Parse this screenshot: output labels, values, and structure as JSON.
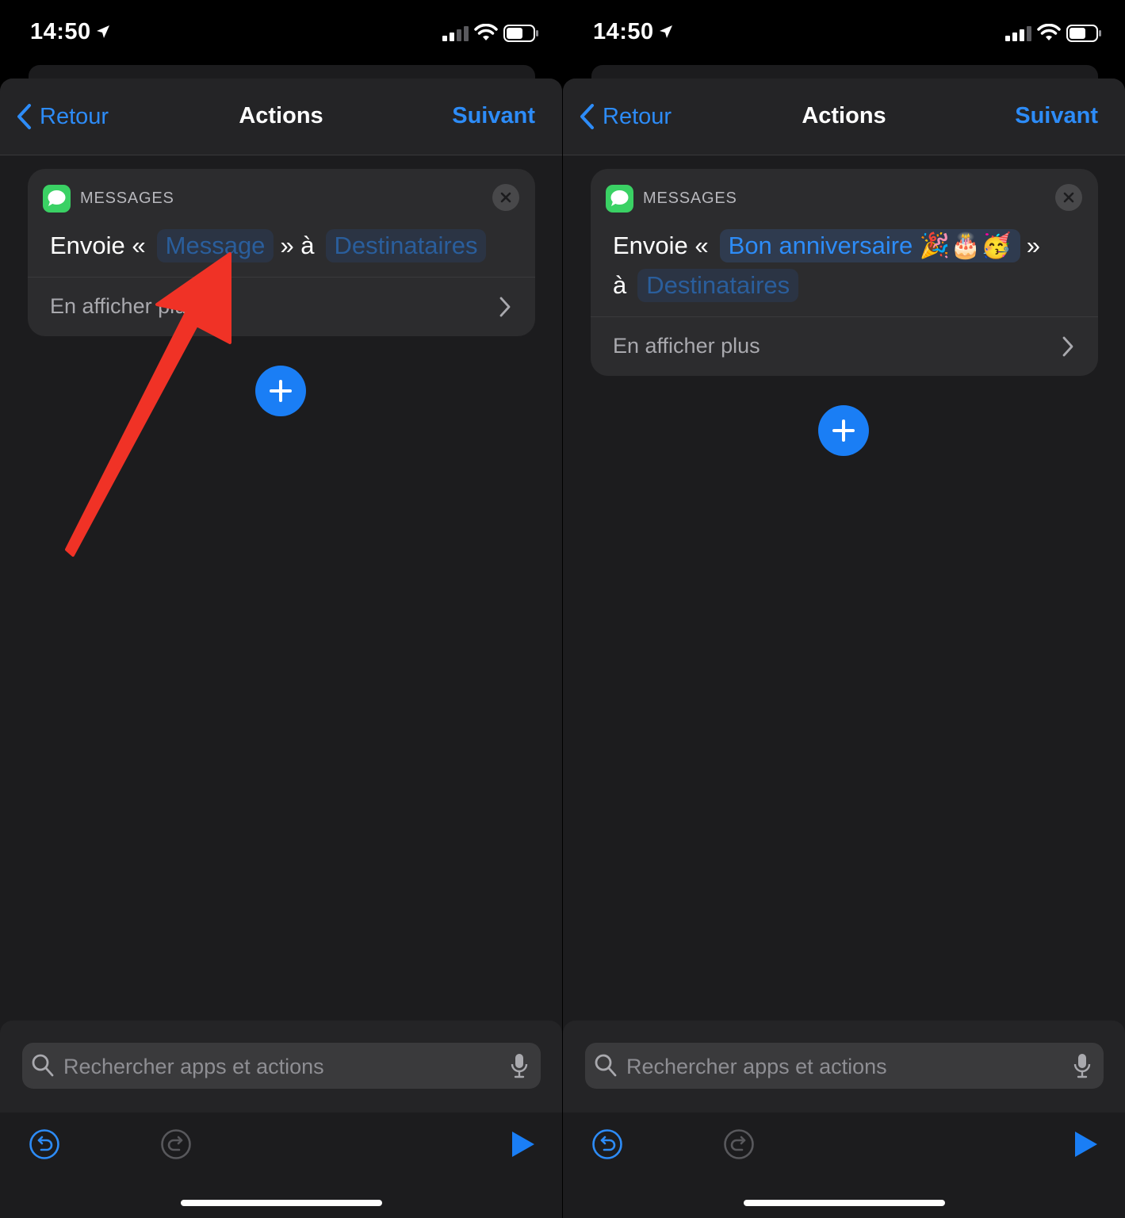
{
  "colors": {
    "accent": "#2d8cf8",
    "background": "#1c1c1e",
    "card": "#2c2c2e",
    "messages_green": "#3ad164",
    "annotation_red": "#f03226"
  },
  "screens": [
    {
      "status": {
        "time": "14:50"
      },
      "nav": {
        "back_label": "Retour",
        "title": "Actions",
        "next_label": "Suivant"
      },
      "card": {
        "app_name": "MESSAGES",
        "verb": "Envoie «",
        "message_value": "Message",
        "connector": "» à",
        "recipients_value": "Destinataires",
        "more_label": "En afficher plus"
      },
      "search": {
        "placeholder": "Rechercher apps et actions"
      }
    },
    {
      "status": {
        "time": "14:50"
      },
      "nav": {
        "back_label": "Retour",
        "title": "Actions",
        "next_label": "Suivant"
      },
      "card": {
        "app_name": "MESSAGES",
        "verb": "Envoie «",
        "message_value": "Bon anniversaire 🎉🎂🥳",
        "close_quote": "»",
        "connector": "à",
        "recipients_value": "Destinataires",
        "more_label": "En afficher plus"
      },
      "search": {
        "placeholder": "Rechercher apps et actions"
      }
    }
  ],
  "icons": [
    "location-arrow-icon",
    "signal-icon",
    "wifi-icon",
    "battery-icon",
    "back-chevron-icon",
    "messages-app-icon",
    "close-icon",
    "chevron-right-icon",
    "plus-icon",
    "search-icon",
    "microphone-icon",
    "undo-icon",
    "redo-icon",
    "play-icon",
    "red-arrow-annotation"
  ]
}
